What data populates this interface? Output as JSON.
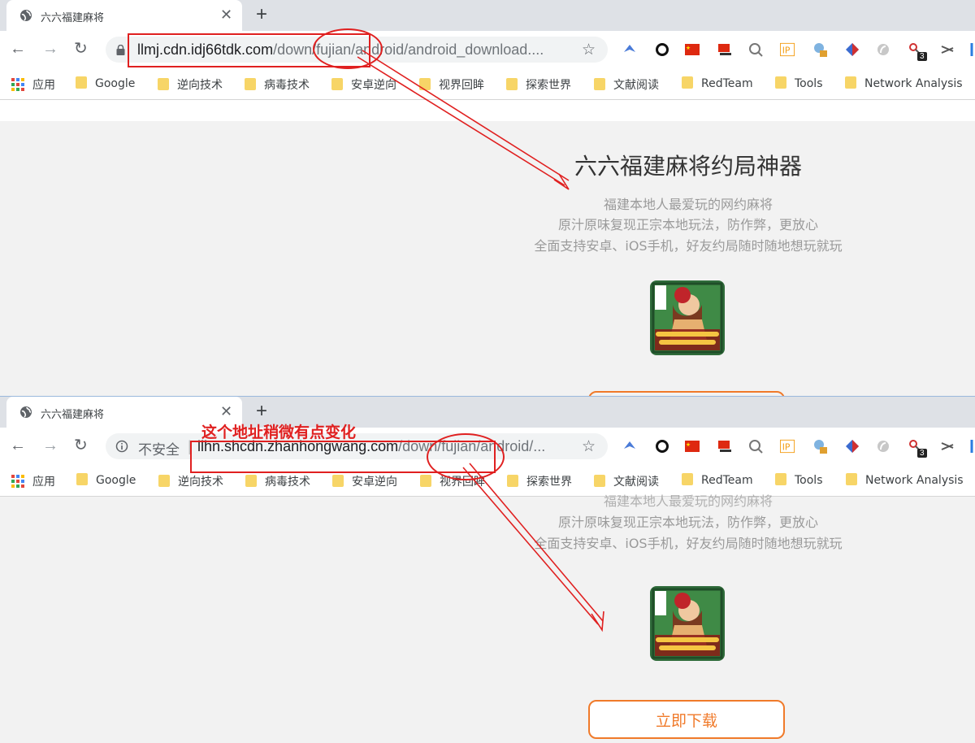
{
  "screens": [
    {
      "tab": {
        "title": "六六福建麻将"
      },
      "url": {
        "host": "llmj.cdn.idj66tdk.com",
        "path": "/down/fujian/android/android_download...."
      },
      "security": {
        "icon": "lock-icon"
      },
      "page": {
        "title": "六六福建麻将约局神器",
        "taglines": [
          "福建本地人最爱玩的网约麻将",
          "原汁原味复现正宗本地玩法，防作弊，更放心",
          "全面支持安卓、iOS手机，好友约局随时随地想玩就玩"
        ]
      }
    },
    {
      "tab": {
        "title": "六六福建麻将"
      },
      "url": {
        "host": "llhn.shcdn.zhanhongwang.com",
        "path": "/down/fujian/android/..."
      },
      "security": {
        "icon": "info-icon",
        "label": "不安全"
      },
      "annotation": "这个地址稍微有点变化",
      "page": {
        "taglines": [
          "福建本地人最爱玩的网约麻将",
          "原汁原味复现正宗本地玩法，防作弊，更放心",
          "全面支持安卓、iOS手机，好友约局随时随地想玩就玩"
        ],
        "download_label": "立即下载"
      }
    }
  ],
  "bookmarks": [
    "应用",
    "Google",
    "逆向技术",
    "病毒技术",
    "安卓逆向",
    "视界回眸",
    "探索世界",
    "文献阅读",
    "RedTeam",
    "Tools",
    "Network Analysis"
  ],
  "extension_badge": "3",
  "icons": [
    "globe-icon",
    "close-icon",
    "plus-icon",
    "back-icon",
    "forward-icon",
    "reload-icon",
    "star-icon",
    "apps-icon",
    "folder-icon"
  ],
  "colors": {
    "highlight": "#e02020",
    "download": "#f07a2a",
    "folder": "#f7d567"
  }
}
